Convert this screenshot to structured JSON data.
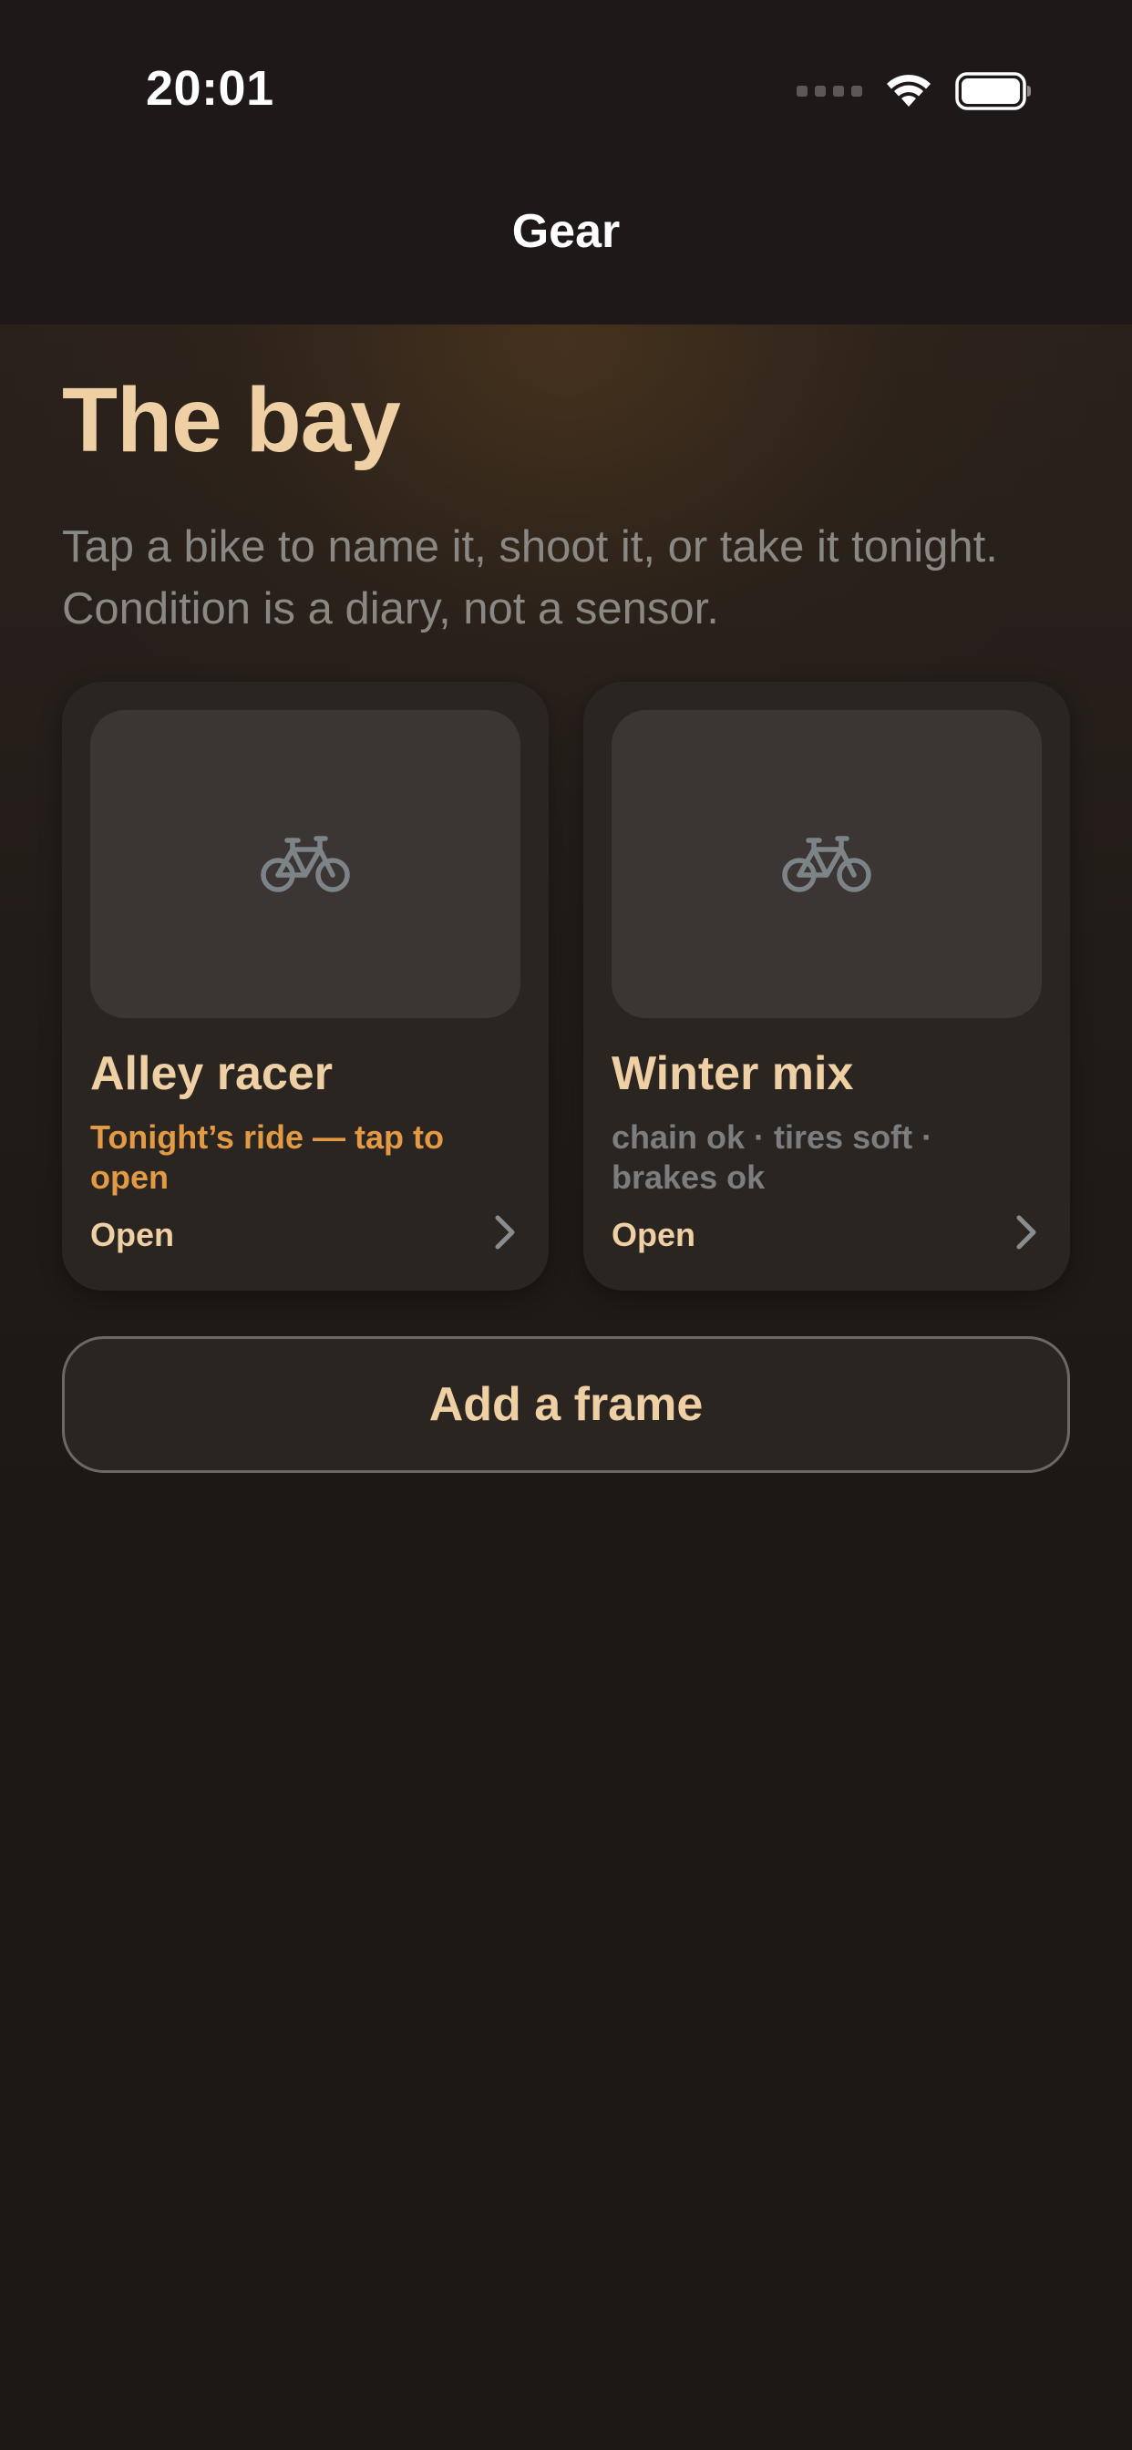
{
  "status_bar": {
    "time": "20:01",
    "icons": [
      "cellular-signal-icon",
      "wifi-icon",
      "battery-icon"
    ]
  },
  "nav": {
    "title": "Gear"
  },
  "main": {
    "heading": "The bay",
    "subtitle": "Tap a bike to name it, shoot it, or take it tonight. Condition is a diary, not a sensor.",
    "bikes": [
      {
        "name": "Alley racer",
        "meta": "Tonight’s ride — tap to open",
        "action": "Open",
        "icon": "bicycle-icon"
      },
      {
        "name": "Winter mix",
        "meta": "chain ok · tires soft · brakes ok",
        "action": "Open",
        "icon": "bicycle-icon"
      }
    ],
    "add_button_label": "Add a frame"
  },
  "colors": {
    "background": "#1d1816",
    "accent_gold": "#efcfa4",
    "accent_orange": "#e29a45",
    "muted_text": "#8a8884",
    "card": "#2b2522",
    "thumb": "#3b3533"
  }
}
